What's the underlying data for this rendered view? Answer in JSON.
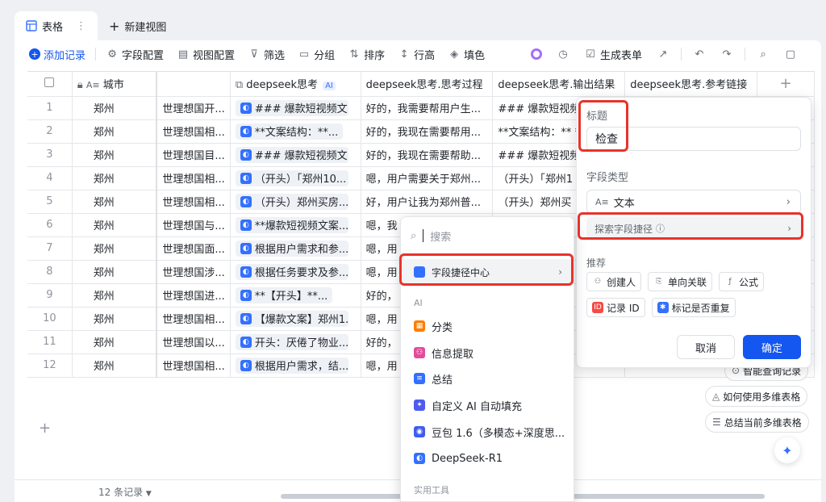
{
  "tabs": {
    "active_label": "表格",
    "new_view_label": "新建视图"
  },
  "toolbar": {
    "add_record": "添加记录",
    "field_config": "字段配置",
    "view_config": "视图配置",
    "filter": "筛选",
    "group": "分组",
    "sort": "排序",
    "row_height": "行高",
    "fill": "填色",
    "generate_form": "生成表单"
  },
  "grid": {
    "headers": {
      "city": "城市",
      "deepseek": "deepseek思考",
      "ai_badge": "AI",
      "process": "deepseek思考.思考过程",
      "output": "deepseek思考.输出结果",
      "links": "deepseek思考.参考链接",
      "add": "+"
    },
    "rows": [
      {
        "idx": "1",
        "city": "郑州",
        "prompt": "世理想国开...",
        "ds": "### 爆款短视频文...",
        "process": "好的，我需要帮用户生...",
        "output": "### 爆款短视频文"
      },
      {
        "idx": "2",
        "city": "郑州",
        "prompt": "世理想国相...",
        "ds": "**文案结构：**...",
        "process": "好的，我现在需要帮用...",
        "output": "**文案结构：** *"
      },
      {
        "idx": "3",
        "city": "郑州",
        "prompt": "世理想国目...",
        "ds": "### 爆款短视频文...",
        "process": "好的，我现在需要帮助...",
        "output": "### 爆款短视频文"
      },
      {
        "idx": "4",
        "city": "郑州",
        "prompt": "世理想国相...",
        "ds": "（开头）「郑州10...",
        "process": "嗯，用户需要关于郑州...",
        "output": "（开头）「郑州1"
      },
      {
        "idx": "5",
        "city": "郑州",
        "prompt": "世理想国相...",
        "ds": "（开头）郑州买房...",
        "process": "好，用户让我为郑州普...",
        "output": "（开头）郑州买"
      },
      {
        "idx": "6",
        "city": "郑州",
        "prompt": "世理想国与...",
        "ds": "**爆款短视频文案...",
        "process": "嗯，我",
        "output": ""
      },
      {
        "idx": "7",
        "city": "郑州",
        "prompt": "世理想国面...",
        "ds": "根据用户需求和参...",
        "process": "嗯，用",
        "output": ""
      },
      {
        "idx": "8",
        "city": "郑州",
        "prompt": "世理想国涉...",
        "ds": "根据任务要求及参...",
        "process": "嗯，用",
        "output": ""
      },
      {
        "idx": "9",
        "city": "郑州",
        "prompt": "世理想国进...",
        "ds": "**【开头】**...",
        "process": "好的，",
        "output": ""
      },
      {
        "idx": "10",
        "city": "郑州",
        "prompt": "世理想国相...",
        "ds": "【爆款文案】郑州1...",
        "process": "嗯，用",
        "output": ""
      },
      {
        "idx": "11",
        "city": "郑州",
        "prompt": "世理想国以...",
        "ds": "开头：厌倦了物业...",
        "process": "好的，",
        "output": ""
      },
      {
        "idx": "12",
        "city": "郑州",
        "prompt": "世理想国相...",
        "ds": "根据用户需求，结...",
        "process": "嗯，用",
        "output": ""
      }
    ]
  },
  "status": {
    "record_count": "12 条记录"
  },
  "panel": {
    "title_label": "标题",
    "title_value": "检查",
    "type_label": "字段类型",
    "type_value": "文本",
    "explore_label": "探索字段捷径",
    "recommend_label": "推荐",
    "chips": [
      "创建人",
      "单向关联",
      "公式",
      "记录 ID",
      "标记是否重复"
    ],
    "cancel": "取消",
    "confirm": "确定"
  },
  "dropdown": {
    "search_placeholder": "搜索",
    "shortcut_center": "字段捷径中心",
    "ai_section": "AI",
    "items": [
      "分类",
      "信息提取",
      "总结",
      "自定义 AI 自动填充",
      "豆包 1.6（多模态+深度思...",
      "DeepSeek-R1"
    ],
    "tools_section": "实用工具"
  },
  "helpers": {
    "smart_query": "智能查询记录",
    "how_to": "如何使用多维表格",
    "summarize": "总结当前多维表格"
  },
  "colors": {
    "accent": "#1456f0",
    "highlight_border": "#e8332a"
  }
}
